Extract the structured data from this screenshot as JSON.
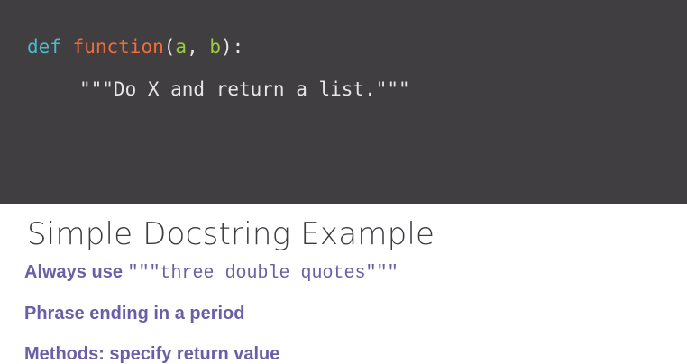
{
  "code": {
    "keyword": "def",
    "function_name": "function",
    "open_paren": "(",
    "param_a": "a",
    "comma": ", ",
    "param_b": "b",
    "close_paren_colon": "):",
    "docstring": "\"\"\"Do X and return a list.\"\"\""
  },
  "slide": {
    "title": "Simple Docstring Example",
    "bullets": [
      {
        "text": "Always use ",
        "code": "\"\"\"three double quotes\"\"\""
      },
      {
        "text": "Phrase ending in a period"
      },
      {
        "text": "Methods: specify return value"
      }
    ]
  },
  "colors": {
    "code_background": "#403e40",
    "keyword": "#4fb8c9",
    "function_name": "#f26b3a",
    "parameter": "#9ccc3d",
    "code_text": "#e6e6e6",
    "title_text": "#3d3b40",
    "bullet_text": "#6a5fa6"
  }
}
